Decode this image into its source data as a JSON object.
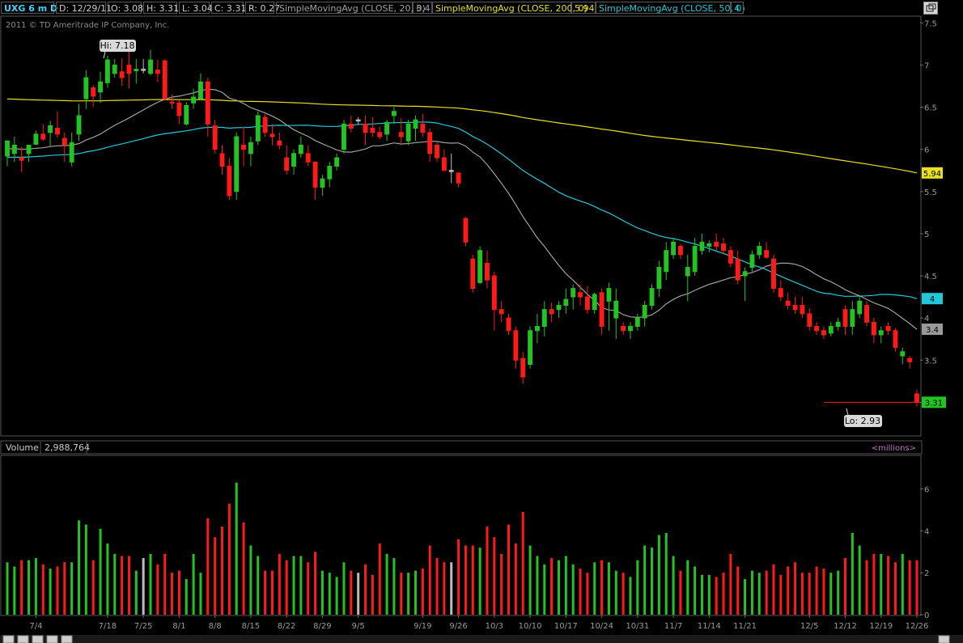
{
  "header": {
    "symbol": "UXG 6 m D",
    "date": "D: 12/29/11",
    "open": "O: 3.08",
    "high": "H: 3.31",
    "low": "L: 3.04",
    "close": "C: 3.31",
    "range": "R: 0.27",
    "sma20_label": "SimpleMovingAvg (CLOSE, 20, 0)",
    "sma20_value": "3.4",
    "sma200_label": "SimpleMovingAvg (CLOSE, 200, 0)",
    "sma200_value": "5.94",
    "sma50_label": "SimpleMovingAvg (CLOSE, 50, 0)",
    "sma50_value": "4"
  },
  "copyright": "2011 © TD Ameritrade IP Company, Inc.",
  "volume_panel": {
    "label": "Volume",
    "value": "2,988,764",
    "units": "<millions>"
  },
  "colors": {
    "up": "#22c322",
    "down": "#ff1a1a",
    "flat": "#bbbbbb",
    "sma20": "#a0a0a0",
    "sma50": "#22c8d8",
    "sma200": "#e8e020",
    "grid": "#555555"
  },
  "chart_data": {
    "type": "candlestick",
    "symbol": "UXG",
    "period": "6 m D",
    "price_ylim": [
      2.62,
      7.56
    ],
    "price_ticks": [
      "7.5",
      "7",
      "6.5",
      "6",
      "5.5",
      "5",
      "4.5",
      "4",
      "3.5",
      "3"
    ],
    "volume_ylim": [
      0,
      7.6
    ],
    "volume_ticks": [
      "0",
      "2",
      "4",
      "6"
    ],
    "x_ticks": [
      {
        "i": 4,
        "label": "7/4"
      },
      {
        "i": 14,
        "label": "7/18"
      },
      {
        "i": 19,
        "label": "7/25"
      },
      {
        "i": 24,
        "label": "8/1"
      },
      {
        "i": 29,
        "label": "8/8"
      },
      {
        "i": 34,
        "label": "8/15"
      },
      {
        "i": 39,
        "label": "8/22"
      },
      {
        "i": 44,
        "label": "8/29"
      },
      {
        "i": 49,
        "label": "9/5"
      },
      {
        "i": 58,
        "label": "9/19"
      },
      {
        "i": 63,
        "label": "9/26"
      },
      {
        "i": 68,
        "label": "10/3"
      },
      {
        "i": 73,
        "label": "10/10"
      },
      {
        "i": 78,
        "label": "10/17"
      },
      {
        "i": 83,
        "label": "10/24"
      },
      {
        "i": 88,
        "label": "10/31"
      },
      {
        "i": 93,
        "label": "11/7"
      },
      {
        "i": 98,
        "label": "11/14"
      },
      {
        "i": 103,
        "label": "11/21"
      },
      {
        "i": 112,
        "label": "12/5"
      },
      {
        "i": 117,
        "label": "12/12"
      },
      {
        "i": 122,
        "label": "12/19"
      },
      {
        "i": 127,
        "label": "12/26"
      }
    ],
    "candles": [
      {
        "o": 5.92,
        "h": 6.07,
        "l": 5.8,
        "c": 6.1,
        "v": 2.5
      },
      {
        "o": 5.95,
        "h": 6.15,
        "l": 5.85,
        "c": 6.05,
        "v": 2.3
      },
      {
        "o": 5.9,
        "h": 6.03,
        "l": 5.73,
        "c": 5.87,
        "v": 2.6
      },
      {
        "o": 5.95,
        "h": 6.02,
        "l": 5.85,
        "c": 6.05,
        "v": 2.6
      },
      {
        "o": 6.06,
        "h": 6.22,
        "l": 6.05,
        "c": 6.18,
        "v": 2.7
      },
      {
        "o": 6.18,
        "h": 6.3,
        "l": 6.1,
        "c": 6.12,
        "v": 2.4
      },
      {
        "o": 6.2,
        "h": 6.34,
        "l": 6.04,
        "c": 6.28,
        "v": 2.2
      },
      {
        "o": 6.25,
        "h": 6.45,
        "l": 6.14,
        "c": 6.18,
        "v": 2.3
      },
      {
        "o": 6.13,
        "h": 6.2,
        "l": 5.85,
        "c": 6.05,
        "v": 2.5
      },
      {
        "o": 5.85,
        "h": 6.2,
        "l": 5.8,
        "c": 6.08,
        "v": 2.5
      },
      {
        "o": 6.18,
        "h": 6.54,
        "l": 6.1,
        "c": 6.4,
        "v": 4.5
      },
      {
        "o": 6.6,
        "h": 6.94,
        "l": 6.48,
        "c": 6.85,
        "v": 4.3
      },
      {
        "o": 6.73,
        "h": 6.76,
        "l": 6.5,
        "c": 6.63,
        "v": 2.6
      },
      {
        "o": 6.68,
        "h": 6.92,
        "l": 6.55,
        "c": 6.8,
        "v": 4.1
      },
      {
        "o": 6.79,
        "h": 7.11,
        "l": 6.73,
        "c": 7.06,
        "v": 3.4
      },
      {
        "o": 6.9,
        "h": 7.07,
        "l": 6.85,
        "c": 7.0,
        "v": 2.9
      },
      {
        "o": 6.92,
        "h": 7.08,
        "l": 6.75,
        "c": 6.85,
        "v": 2.8
      },
      {
        "o": 7.0,
        "h": 7.18,
        "l": 6.72,
        "c": 6.9,
        "v": 2.8
      },
      {
        "o": 6.93,
        "h": 7.07,
        "l": 6.78,
        "c": 6.95,
        "v": 2.1
      },
      {
        "o": 6.95,
        "h": 7.07,
        "l": 6.9,
        "c": 6.95,
        "v": 2.7
      },
      {
        "o": 6.9,
        "h": 7.18,
        "l": 6.88,
        "c": 7.06,
        "v": 2.9
      },
      {
        "o": 6.94,
        "h": 7.06,
        "l": 6.8,
        "c": 6.9,
        "v": 2.4
      },
      {
        "o": 7.05,
        "h": 7.07,
        "l": 6.58,
        "c": 6.6,
        "v": 2.9
      },
      {
        "o": 6.56,
        "h": 6.65,
        "l": 6.48,
        "c": 6.55,
        "v": 2.0
      },
      {
        "o": 6.55,
        "h": 6.58,
        "l": 6.3,
        "c": 6.4,
        "v": 2.1
      },
      {
        "o": 6.3,
        "h": 6.56,
        "l": 6.28,
        "c": 6.52,
        "v": 1.7
      },
      {
        "o": 6.55,
        "h": 6.72,
        "l": 6.48,
        "c": 6.62,
        "v": 2.9
      },
      {
        "o": 6.6,
        "h": 6.9,
        "l": 6.58,
        "c": 6.8,
        "v": 2.0
      },
      {
        "o": 6.8,
        "h": 6.85,
        "l": 6.15,
        "c": 6.3,
        "v": 4.6
      },
      {
        "o": 6.28,
        "h": 6.35,
        "l": 5.95,
        "c": 6.0,
        "v": 3.7
      },
      {
        "o": 5.95,
        "h": 6.05,
        "l": 5.7,
        "c": 5.8,
        "v": 4.2
      },
      {
        "o": 5.8,
        "h": 5.9,
        "l": 5.4,
        "c": 5.45,
        "v": 5.3
      },
      {
        "o": 5.5,
        "h": 6.2,
        "l": 5.4,
        "c": 6.15,
        "v": 6.3
      },
      {
        "o": 6.05,
        "h": 6.27,
        "l": 5.8,
        "c": 6.0,
        "v": 4.4
      },
      {
        "o": 5.95,
        "h": 6.15,
        "l": 5.8,
        "c": 6.08,
        "v": 3.3
      },
      {
        "o": 6.1,
        "h": 6.45,
        "l": 6.05,
        "c": 6.4,
        "v": 2.8
      },
      {
        "o": 6.38,
        "h": 6.42,
        "l": 6.15,
        "c": 6.2,
        "v": 2.1
      },
      {
        "o": 6.18,
        "h": 6.3,
        "l": 6.05,
        "c": 6.15,
        "v": 2.1
      },
      {
        "o": 6.1,
        "h": 6.2,
        "l": 6.0,
        "c": 6.05,
        "v": 2.9
      },
      {
        "o": 5.9,
        "h": 6.05,
        "l": 5.7,
        "c": 5.75,
        "v": 2.6
      },
      {
        "o": 5.8,
        "h": 6.0,
        "l": 5.7,
        "c": 5.95,
        "v": 2.8
      },
      {
        "o": 5.95,
        "h": 6.15,
        "l": 5.9,
        "c": 6.05,
        "v": 2.8
      },
      {
        "o": 5.95,
        "h": 6.05,
        "l": 5.8,
        "c": 5.85,
        "v": 2.5
      },
      {
        "o": 5.85,
        "h": 5.85,
        "l": 5.4,
        "c": 5.55,
        "v": 3.0
      },
      {
        "o": 5.55,
        "h": 5.7,
        "l": 5.45,
        "c": 5.65,
        "v": 2.1
      },
      {
        "o": 5.65,
        "h": 5.85,
        "l": 5.55,
        "c": 5.8,
        "v": 2.0
      },
      {
        "o": 5.8,
        "h": 5.95,
        "l": 5.75,
        "c": 5.9,
        "v": 1.8
      },
      {
        "o": 6.0,
        "h": 6.35,
        "l": 5.95,
        "c": 6.3,
        "v": 2.5
      },
      {
        "o": 6.3,
        "h": 6.4,
        "l": 6.2,
        "c": 6.25,
        "v": 2.1
      },
      {
        "o": 6.35,
        "h": 6.38,
        "l": 6.3,
        "c": 6.35,
        "v": 2.0
      },
      {
        "o": 6.3,
        "h": 6.4,
        "l": 6.05,
        "c": 6.2,
        "v": 2.4
      },
      {
        "o": 6.25,
        "h": 6.38,
        "l": 6.15,
        "c": 6.2,
        "v": 1.9
      },
      {
        "o": 6.2,
        "h": 6.27,
        "l": 6.12,
        "c": 6.15,
        "v": 3.4
      },
      {
        "o": 6.18,
        "h": 6.35,
        "l": 6.1,
        "c": 6.32,
        "v": 2.9
      },
      {
        "o": 6.4,
        "h": 6.5,
        "l": 6.3,
        "c": 6.45,
        "v": 2.7
      },
      {
        "o": 6.2,
        "h": 6.37,
        "l": 6.05,
        "c": 6.15,
        "v": 2.0
      },
      {
        "o": 6.1,
        "h": 6.35,
        "l": 6.05,
        "c": 6.3,
        "v": 2.0
      },
      {
        "o": 6.25,
        "h": 6.4,
        "l": 6.1,
        "c": 6.35,
        "v": 2.1
      },
      {
        "o": 6.3,
        "h": 6.42,
        "l": 6.15,
        "c": 6.2,
        "v": 2.2
      },
      {
        "o": 6.2,
        "h": 6.25,
        "l": 5.85,
        "c": 5.95,
        "v": 3.3
      },
      {
        "o": 6.05,
        "h": 6.08,
        "l": 5.85,
        "c": 5.9,
        "v": 2.7
      },
      {
        "o": 5.9,
        "h": 6.0,
        "l": 5.75,
        "c": 5.75,
        "v": 2.5
      },
      {
        "o": 5.75,
        "h": 5.95,
        "l": 5.6,
        "c": 5.75,
        "v": 2.5
      },
      {
        "o": 5.72,
        "h": 5.72,
        "l": 5.55,
        "c": 5.6,
        "v": 3.6
      },
      {
        "o": 5.18,
        "h": 5.2,
        "l": 4.85,
        "c": 4.9,
        "v": 3.3
      },
      {
        "o": 4.7,
        "h": 4.75,
        "l": 4.3,
        "c": 4.35,
        "v": 3.3
      },
      {
        "o": 4.42,
        "h": 4.85,
        "l": 4.4,
        "c": 4.8,
        "v": 3.2
      },
      {
        "o": 4.65,
        "h": 4.8,
        "l": 4.35,
        "c": 4.45,
        "v": 4.2
      },
      {
        "o": 4.5,
        "h": 4.55,
        "l": 3.85,
        "c": 4.1,
        "v": 3.7
      },
      {
        "o": 4.1,
        "h": 4.2,
        "l": 3.95,
        "c": 4.05,
        "v": 2.9
      },
      {
        "o": 4.0,
        "h": 4.05,
        "l": 3.8,
        "c": 3.85,
        "v": 4.3
      },
      {
        "o": 3.85,
        "h": 3.9,
        "l": 3.4,
        "c": 3.5,
        "v": 3.4
      },
      {
        "o": 3.52,
        "h": 3.6,
        "l": 3.22,
        "c": 3.3,
        "v": 4.9
      },
      {
        "o": 3.45,
        "h": 3.9,
        "l": 3.4,
        "c": 3.85,
        "v": 3.3
      },
      {
        "o": 3.85,
        "h": 4.05,
        "l": 3.7,
        "c": 3.9,
        "v": 2.8
      },
      {
        "o": 3.9,
        "h": 4.2,
        "l": 3.78,
        "c": 4.1,
        "v": 2.4
      },
      {
        "o": 4.1,
        "h": 4.18,
        "l": 3.95,
        "c": 4.05,
        "v": 2.7
      },
      {
        "o": 4.1,
        "h": 4.2,
        "l": 4.0,
        "c": 4.15,
        "v": 2.6
      },
      {
        "o": 4.15,
        "h": 4.35,
        "l": 4.05,
        "c": 4.22,
        "v": 2.8
      },
      {
        "o": 4.25,
        "h": 4.4,
        "l": 4.1,
        "c": 4.35,
        "v": 2.4
      },
      {
        "o": 4.3,
        "h": 4.4,
        "l": 4.15,
        "c": 4.25,
        "v": 2.2
      },
      {
        "o": 4.25,
        "h": 4.38,
        "l": 4.05,
        "c": 4.1,
        "v": 2.0
      },
      {
        "o": 4.1,
        "h": 4.3,
        "l": 4.05,
        "c": 4.28,
        "v": 2.5
      },
      {
        "o": 4.3,
        "h": 4.35,
        "l": 3.8,
        "c": 3.9,
        "v": 2.6
      },
      {
        "o": 4.2,
        "h": 4.42,
        "l": 3.85,
        "c": 4.35,
        "v": 2.5
      },
      {
        "o": 4.0,
        "h": 4.35,
        "l": 3.75,
        "c": 4.2,
        "v": 2.1
      },
      {
        "o": 3.9,
        "h": 3.95,
        "l": 3.8,
        "c": 3.85,
        "v": 2.0
      },
      {
        "o": 3.85,
        "h": 3.95,
        "l": 3.75,
        "c": 3.9,
        "v": 1.8
      },
      {
        "o": 3.9,
        "h": 4.05,
        "l": 3.85,
        "c": 4.0,
        "v": 2.6
      },
      {
        "o": 4.0,
        "h": 4.2,
        "l": 3.9,
        "c": 4.15,
        "v": 3.3
      },
      {
        "o": 4.15,
        "h": 4.4,
        "l": 4.1,
        "c": 4.35,
        "v": 3.2
      },
      {
        "o": 4.35,
        "h": 4.68,
        "l": 4.25,
        "c": 4.6,
        "v": 3.8
      },
      {
        "o": 4.55,
        "h": 4.9,
        "l": 4.45,
        "c": 4.8,
        "v": 3.9
      },
      {
        "o": 4.75,
        "h": 4.95,
        "l": 4.7,
        "c": 4.9,
        "v": 2.8
      },
      {
        "o": 4.85,
        "h": 4.88,
        "l": 4.7,
        "c": 4.75,
        "v": 2.1
      },
      {
        "o": 4.5,
        "h": 4.75,
        "l": 4.2,
        "c": 4.6,
        "v": 2.6
      },
      {
        "o": 4.55,
        "h": 4.95,
        "l": 4.5,
        "c": 4.85,
        "v": 2.3
      },
      {
        "o": 4.8,
        "h": 5.0,
        "l": 4.75,
        "c": 4.9,
        "v": 1.9
      },
      {
        "o": 4.85,
        "h": 4.92,
        "l": 4.78,
        "c": 4.88,
        "v": 1.9
      },
      {
        "o": 4.9,
        "h": 5.0,
        "l": 4.8,
        "c": 4.85,
        "v": 1.8
      },
      {
        "o": 4.88,
        "h": 4.95,
        "l": 4.75,
        "c": 4.8,
        "v": 2.0
      },
      {
        "o": 4.8,
        "h": 4.85,
        "l": 4.6,
        "c": 4.65,
        "v": 2.9
      },
      {
        "o": 4.7,
        "h": 4.8,
        "l": 4.4,
        "c": 4.45,
        "v": 2.3
      },
      {
        "o": 4.5,
        "h": 4.6,
        "l": 4.2,
        "c": 4.55,
        "v": 1.7
      },
      {
        "o": 4.6,
        "h": 4.8,
        "l": 4.55,
        "c": 4.75,
        "v": 2.1
      },
      {
        "o": 4.75,
        "h": 4.9,
        "l": 4.7,
        "c": 4.85,
        "v": 2.0
      },
      {
        "o": 4.8,
        "h": 4.9,
        "l": 4.7,
        "c": 4.72,
        "v": 2.1
      },
      {
        "o": 4.7,
        "h": 4.75,
        "l": 4.3,
        "c": 4.35,
        "v": 2.4
      },
      {
        "o": 4.35,
        "h": 4.45,
        "l": 4.2,
        "c": 4.25,
        "v": 1.9
      },
      {
        "o": 4.2,
        "h": 4.3,
        "l": 4.1,
        "c": 4.15,
        "v": 2.3
      },
      {
        "o": 4.15,
        "h": 4.25,
        "l": 4.05,
        "c": 4.1,
        "v": 2.5
      },
      {
        "o": 4.15,
        "h": 4.25,
        "l": 4.0,
        "c": 4.05,
        "v": 2.0
      },
      {
        "o": 4.05,
        "h": 4.12,
        "l": 3.85,
        "c": 3.9,
        "v": 2.0
      },
      {
        "o": 3.9,
        "h": 3.95,
        "l": 3.8,
        "c": 3.85,
        "v": 2.3
      },
      {
        "o": 3.85,
        "h": 3.9,
        "l": 3.75,
        "c": 3.8,
        "v": 2.2
      },
      {
        "o": 3.82,
        "h": 3.95,
        "l": 3.78,
        "c": 3.9,
        "v": 2.0
      },
      {
        "o": 3.9,
        "h": 4.0,
        "l": 3.85,
        "c": 3.95,
        "v": 2.1
      },
      {
        "o": 4.1,
        "h": 4.15,
        "l": 3.8,
        "c": 3.9,
        "v": 2.7
      },
      {
        "o": 3.9,
        "h": 4.2,
        "l": 3.8,
        "c": 4.1,
        "v": 3.9
      },
      {
        "o": 4.05,
        "h": 4.25,
        "l": 4.0,
        "c": 4.2,
        "v": 3.3
      },
      {
        "o": 4.15,
        "h": 4.2,
        "l": 3.9,
        "c": 3.95,
        "v": 2.6
      },
      {
        "o": 3.95,
        "h": 4.0,
        "l": 3.7,
        "c": 3.8,
        "v": 2.9
      },
      {
        "o": 3.8,
        "h": 3.9,
        "l": 3.7,
        "c": 3.85,
        "v": 2.9
      },
      {
        "o": 3.9,
        "h": 3.95,
        "l": 3.8,
        "c": 3.85,
        "v": 2.8
      },
      {
        "o": 3.85,
        "h": 3.88,
        "l": 3.6,
        "c": 3.65,
        "v": 2.5
      },
      {
        "o": 3.55,
        "h": 3.65,
        "l": 3.45,
        "c": 3.6,
        "v": 2.9
      },
      {
        "o": 3.52,
        "h": 3.55,
        "l": 3.4,
        "c": 3.48,
        "v": 2.6
      },
      {
        "o": 3.1,
        "h": 3.15,
        "l": 2.95,
        "c": 3.0,
        "v": 2.6
      }
    ]
  }
}
